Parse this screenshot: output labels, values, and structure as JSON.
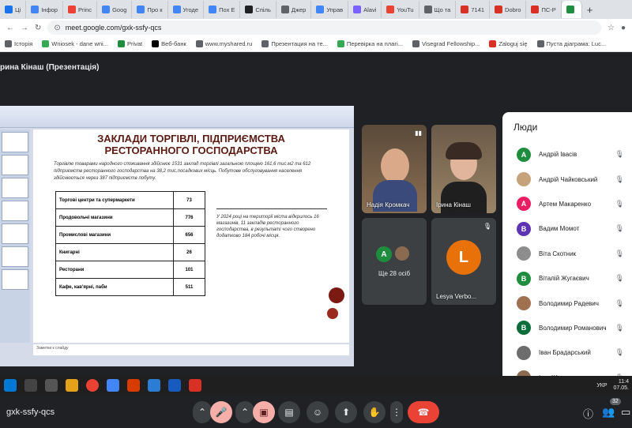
{
  "browser": {
    "tabs": [
      {
        "label": "Ці",
        "color": "#1a73e8"
      },
      {
        "label": "Інфор",
        "color": "#4285f4"
      },
      {
        "label": "Princ",
        "color": "#ea4335"
      },
      {
        "label": "Goog",
        "color": "#4285f4"
      },
      {
        "label": "Про к",
        "color": "#4285f4"
      },
      {
        "label": "Угоде",
        "color": "#4285f4"
      },
      {
        "label": "Пох Е",
        "color": "#4285f4"
      },
      {
        "label": "Спіль",
        "color": "#202124"
      },
      {
        "label": "Джер",
        "color": "#5f6368"
      },
      {
        "label": "Управ",
        "color": "#4285f4"
      },
      {
        "label": "Alavi",
        "color": "#7b61ff"
      },
      {
        "label": "YouTu",
        "color": "#ea4335"
      },
      {
        "label": "Що та",
        "color": "#5f6368"
      },
      {
        "label": "7141",
        "color": "#d93025"
      },
      {
        "label": "Dobro",
        "color": "#d93025"
      },
      {
        "label": "ПС-Р",
        "color": "#d93025"
      },
      {
        "label": "",
        "color": "#1e8e3e"
      }
    ],
    "url": "meet.google.com/gxk-ssfy-qcs",
    "bookmarks": [
      {
        "label": "Історія",
        "color": "#5f6368"
      },
      {
        "label": "Wniosek - dane wni...",
        "color": "#34a853"
      },
      {
        "label": "Privat",
        "color": "#1e8e3e"
      },
      {
        "label": "Веб-банк",
        "color": "#000000"
      },
      {
        "label": "www.myshared.ru",
        "color": "#5f6368"
      },
      {
        "label": "Презентация на те...",
        "color": "#5f6368"
      },
      {
        "label": "Перевірка на плагі...",
        "color": "#34a853"
      },
      {
        "label": "Visegrad Fellowship...",
        "color": "#5f6368"
      },
      {
        "label": "Zaloguj się",
        "color": "#d93025"
      },
      {
        "label": "Пуста діаграма: Luc...",
        "color": "#5f6368"
      }
    ]
  },
  "meet": {
    "presenter_label": "рина Кінаш (Презентація)",
    "meeting_code": "gxk-ssfy-qcs",
    "participant_count": "32",
    "slide": {
      "title": "ЗАКЛАДИ ТОРГІВЛІ, ПІДПРИЄМСТВА РЕСТОРАННОГО ГОСПОДАРСТВА",
      "intro": "Торгівлю товарами народного споживання здійснює 1531 заклад торгівлі загальною площею 161,6 тис.м2 та 612 підприємств ресторанного господарства на 38,2 тис.посадкових місць. Побутове обслуговування населення здійснюється через 387 підприємств побуту.",
      "table": [
        {
          "name": "Торгові центри та супермаркети",
          "value": "73"
        },
        {
          "name": "Продовольчі магазини",
          "value": "776"
        },
        {
          "name": "Промислові магазини",
          "value": "656"
        },
        {
          "name": "Книгарні",
          "value": "26"
        },
        {
          "name": "Ресторани",
          "value": "101"
        },
        {
          "name": "Кафе, кав'ярні, паби",
          "value": "511"
        }
      ],
      "note": "У 2024 році на території міста відкрилось 16 магазинів, 11 закладів ресторанного господарства, в результаті чого створено додатково 184 робочі місця.",
      "notes_placeholder": "Заметки к слайду"
    },
    "tiles": [
      {
        "name": "Надія Кромкач"
      },
      {
        "name": "Ірина Кінаш"
      },
      {
        "name": "Ще 28 осіб",
        "initial": "A"
      },
      {
        "name": "Lesya Verbo...",
        "initial": "L"
      }
    ],
    "people_panel": {
      "title": "Люди",
      "people": [
        {
          "name": "Андрій Івасів",
          "initial": "А",
          "color": "#1e8e3e"
        },
        {
          "name": "Андрій Чайковський",
          "initial": "",
          "color": "#c5a27a"
        },
        {
          "name": "Артем Макаренко",
          "initial": "А",
          "color": "#e91e63"
        },
        {
          "name": "Вадим Момот",
          "initial": "В",
          "color": "#5e35b1"
        },
        {
          "name": "Віта Скотник",
          "initial": "",
          "color": "#8d8d8d"
        },
        {
          "name": "Віталій Жугаєвич",
          "initial": "В",
          "color": "#1e8e3e"
        },
        {
          "name": "Володимир Радевич",
          "initial": "",
          "color": "#a07050"
        },
        {
          "name": "Володимир Романович",
          "initial": "В",
          "color": "#0b6e3a"
        },
        {
          "name": "Іван Брадарський",
          "initial": "",
          "color": "#6d6d6d"
        },
        {
          "name": "Ігор Жук",
          "initial": "",
          "color": "#8a6a50"
        }
      ]
    }
  },
  "taskbar": {
    "lang": "УКР",
    "time": "11:4",
    "date": "07.05."
  }
}
